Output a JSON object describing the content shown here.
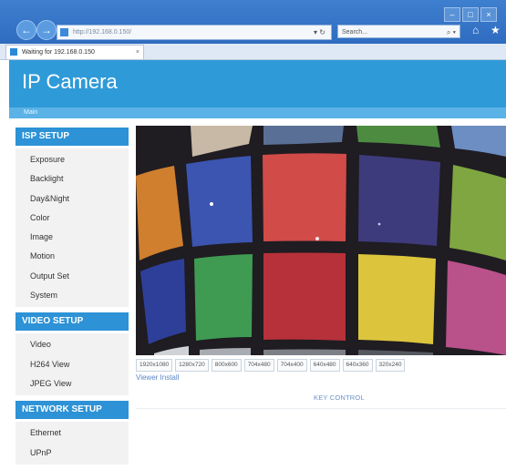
{
  "browser": {
    "url": "http://192.168.0.150/",
    "search_placeholder": "Search...",
    "tab_title": "Waiting for 192.168.0.150",
    "tab_close": "×",
    "refresh_icon": "refresh-icon",
    "dropdown_icon": "chevron-down-icon",
    "search_icon": "search-icon",
    "home_icon": "home-icon",
    "favorites_icon": "star-icon",
    "back_glyph": "←",
    "forward_glyph": "→",
    "addr_ctrls": "▾ ↻",
    "search_ctrls": "⌕ ▾",
    "home_glyph": "⌂",
    "star_glyph": "★",
    "minimize_glyph": "–",
    "maximize_glyph": "□",
    "close_glyph": "×"
  },
  "page": {
    "title": "IP Camera",
    "nav_main": "Main"
  },
  "sidebar": {
    "isp": {
      "heading": "ISP SETUP",
      "items": [
        "Exposure",
        "Backlight",
        "Day&Night",
        "Color",
        "Image",
        "Motion",
        "Output Set",
        "System"
      ]
    },
    "video": {
      "heading": "VIDEO SETUP",
      "items": [
        "Video",
        "H264 View",
        "JPEG View"
      ]
    },
    "network": {
      "heading": "NETWORK SETUP",
      "items": [
        "Ethernet",
        "UPnP"
      ]
    }
  },
  "resolutions": [
    "1920x1080",
    "1280x720",
    "800x600",
    "704x480",
    "704x400",
    "640x480",
    "640x360",
    "320x240"
  ],
  "viewer_install": "Viewer Install",
  "key_control": "KEY CONTROL",
  "colors": {
    "header_blue": "#2f9ad8",
    "section_blue": "#2d92d6",
    "link_blue": "#5b86c5"
  }
}
